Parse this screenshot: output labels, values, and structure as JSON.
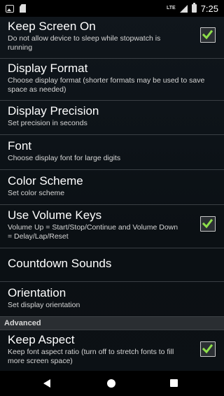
{
  "status_bar": {
    "network_label": "LTE",
    "time": "7:25",
    "icons": [
      "gallery-icon",
      "sd-card-icon",
      "signal-icon",
      "battery-icon"
    ]
  },
  "settings": {
    "keep_screen_on": {
      "title": "Keep Screen On",
      "summary": "Do not allow device to sleep while stopwatch is running",
      "checked": true
    },
    "display_format": {
      "title": "Display Format",
      "summary": "Choose display format (shorter formats may be used to save space as needed)"
    },
    "display_precision": {
      "title": "Display Precision",
      "summary": "Set precision in seconds"
    },
    "font": {
      "title": "Font",
      "summary": "Choose display font for large digits"
    },
    "color_scheme": {
      "title": "Color Scheme",
      "summary": "Set color scheme"
    },
    "use_volume_keys": {
      "title": "Use Volume Keys",
      "summary": "Volume Up = Start/Stop/Continue and Volume Down = Delay/Lap/Reset",
      "checked": true
    },
    "countdown_sounds": {
      "title": "Countdown Sounds"
    },
    "orientation": {
      "title": "Orientation",
      "summary": "Set display orientation"
    },
    "advanced_category": "Advanced",
    "keep_aspect": {
      "title": "Keep Aspect",
      "summary": "Keep font aspect ratio (turn off to stretch fonts to fill more screen space)",
      "checked": true
    }
  },
  "colors": {
    "check_green": "#8ee04a",
    "checkbox_border": "#c8c8c8",
    "background": "#0d1318",
    "category_bg": "#2a2e32"
  },
  "nav_bar": {
    "icons": [
      "back-icon",
      "home-icon",
      "recents-icon"
    ]
  }
}
